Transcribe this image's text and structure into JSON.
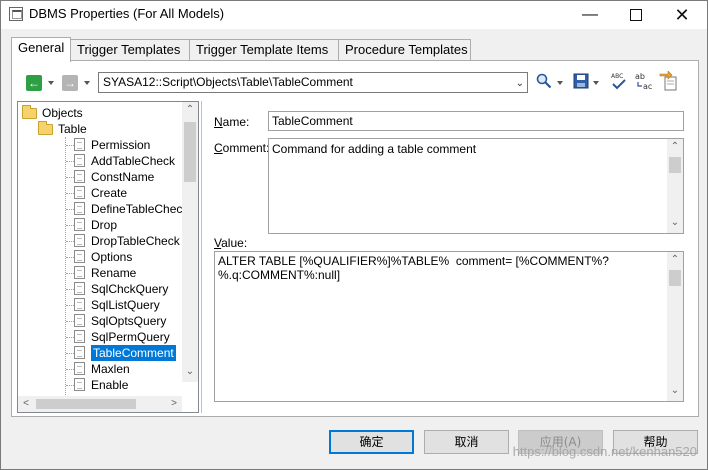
{
  "window": {
    "title": "DBMS Properties (For All Models)"
  },
  "tabs": [
    "General",
    "Trigger Templates",
    "Trigger Template Items",
    "Procedure Templates"
  ],
  "toolbar": {
    "path": "SYASA12::Script\\Objects\\Table\\TableComment"
  },
  "tree": {
    "root": "Objects",
    "folder": "Table",
    "items": [
      "Permission",
      "AddTableCheck",
      "ConstName",
      "Create",
      "DefineTableCheck",
      "Drop",
      "DropTableCheck",
      "Options",
      "Rename",
      "SqlChckQuery",
      "SqlListQuery",
      "SqlOptsQuery",
      "SqlPermQuery",
      "TableComment",
      "Maxlen",
      "Enable"
    ],
    "selected": "TableComment"
  },
  "form": {
    "name_label_ul": "N",
    "name_label_rest": "ame:",
    "name_value": "TableComment",
    "comment_label_ul": "C",
    "comment_label_rest": "omment:",
    "comment_value": "Command for adding a table comment",
    "value_label_ul": "V",
    "value_label_rest": "alue:",
    "value_line1": "ALTER TABLE [%QUALIFIER%]%TABLE%  comment= [%COMMENT%?",
    "value_line2": "%.q:COMMENT%:null]"
  },
  "buttons": {
    "ok": "确定",
    "cancel": "取消",
    "apply": "应用(A)",
    "help": "帮助"
  },
  "watermark": "https://blog.csdn.net/kenhan520",
  "colors": {
    "selection": "#0078d7",
    "back_arrow": "#2ea043"
  }
}
